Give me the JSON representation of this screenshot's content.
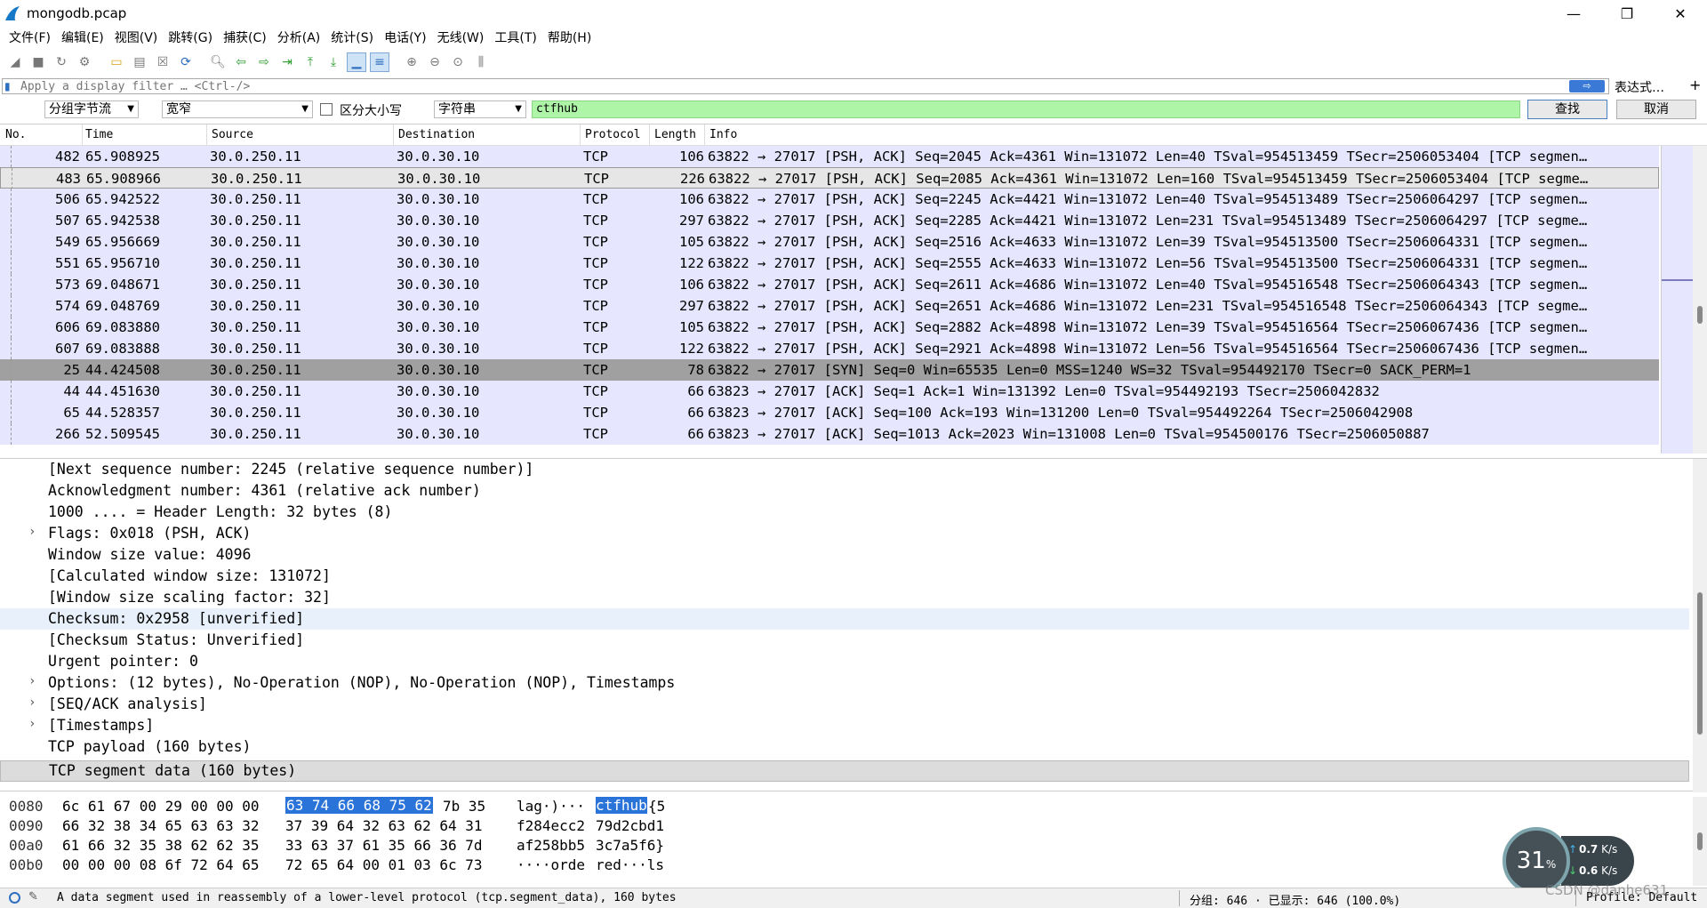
{
  "window": {
    "title": "mongodb.pcap",
    "minimize": "—",
    "restore": "❐",
    "close": "✕"
  },
  "menu": [
    "文件(F)",
    "编辑(E)",
    "视图(V)",
    "跳转(G)",
    "捕获(C)",
    "分析(A)",
    "统计(S)",
    "电话(Y)",
    "无线(W)",
    "工具(T)",
    "帮助(H)"
  ],
  "display_filter": {
    "placeholder": "Apply a display filter … <Ctrl-/>",
    "expression_label": "表达式…",
    "plus": "+"
  },
  "find_bar": {
    "search_in": "分组字节流",
    "char_width": "宽窄",
    "case_sensitive_label": "区分大小写",
    "search_type": "字符串",
    "query": "ctfhub",
    "find_label": "查找",
    "cancel_label": "取消"
  },
  "packet_list": {
    "columns": [
      "No.",
      "Time",
      "Source",
      "Destination",
      "Protocol",
      "Length",
      "Info"
    ],
    "rows": [
      {
        "no": "482",
        "time": "65.908925",
        "src": "30.0.250.11",
        "dst": "30.0.30.10",
        "proto": "TCP",
        "len": "106",
        "info": "63822 → 27017 [PSH, ACK] Seq=2045 Ack=4361 Win=131072 Len=40 TSval=954513459 TSecr=2506053404 [TCP segmen…"
      },
      {
        "no": "483",
        "time": "65.908966",
        "src": "30.0.250.11",
        "dst": "30.0.30.10",
        "proto": "TCP",
        "len": "226",
        "info": "63822 → 27017 [PSH, ACK] Seq=2085 Ack=4361 Win=131072 Len=160 TSval=954513459 TSecr=2506053404 [TCP segme…"
      },
      {
        "no": "506",
        "time": "65.942522",
        "src": "30.0.250.11",
        "dst": "30.0.30.10",
        "proto": "TCP",
        "len": "106",
        "info": "63822 → 27017 [PSH, ACK] Seq=2245 Ack=4421 Win=131072 Len=40 TSval=954513489 TSecr=2506064297 [TCP segmen…"
      },
      {
        "no": "507",
        "time": "65.942538",
        "src": "30.0.250.11",
        "dst": "30.0.30.10",
        "proto": "TCP",
        "len": "297",
        "info": "63822 → 27017 [PSH, ACK] Seq=2285 Ack=4421 Win=131072 Len=231 TSval=954513489 TSecr=2506064297 [TCP segme…"
      },
      {
        "no": "549",
        "time": "65.956669",
        "src": "30.0.250.11",
        "dst": "30.0.30.10",
        "proto": "TCP",
        "len": "105",
        "info": "63822 → 27017 [PSH, ACK] Seq=2516 Ack=4633 Win=131072 Len=39 TSval=954513500 TSecr=2506064331 [TCP segmen…"
      },
      {
        "no": "551",
        "time": "65.956710",
        "src": "30.0.250.11",
        "dst": "30.0.30.10",
        "proto": "TCP",
        "len": "122",
        "info": "63822 → 27017 [PSH, ACK] Seq=2555 Ack=4633 Win=131072 Len=56 TSval=954513500 TSecr=2506064331 [TCP segmen…"
      },
      {
        "no": "573",
        "time": "69.048671",
        "src": "30.0.250.11",
        "dst": "30.0.30.10",
        "proto": "TCP",
        "len": "106",
        "info": "63822 → 27017 [PSH, ACK] Seq=2611 Ack=4686 Win=131072 Len=40 TSval=954516548 TSecr=2506064343 [TCP segmen…"
      },
      {
        "no": "574",
        "time": "69.048769",
        "src": "30.0.250.11",
        "dst": "30.0.30.10",
        "proto": "TCP",
        "len": "297",
        "info": "63822 → 27017 [PSH, ACK] Seq=2651 Ack=4686 Win=131072 Len=231 TSval=954516548 TSecr=2506064343 [TCP segme…"
      },
      {
        "no": "606",
        "time": "69.083880",
        "src": "30.0.250.11",
        "dst": "30.0.30.10",
        "proto": "TCP",
        "len": "105",
        "info": "63822 → 27017 [PSH, ACK] Seq=2882 Ack=4898 Win=131072 Len=39 TSval=954516564 TSecr=2506067436 [TCP segmen…"
      },
      {
        "no": "607",
        "time": "69.083888",
        "src": "30.0.250.11",
        "dst": "30.0.30.10",
        "proto": "TCP",
        "len": "122",
        "info": "63822 → 27017 [PSH, ACK] Seq=2921 Ack=4898 Win=131072 Len=56 TSval=954516564 TSecr=2506067436 [TCP segmen…"
      },
      {
        "no": "25",
        "time": "44.424508",
        "src": "30.0.250.11",
        "dst": "30.0.30.10",
        "proto": "TCP",
        "len": "78",
        "info": "63822 → 27017 [SYN] Seq=0 Win=65535 Len=0 MSS=1240 WS=32 TSval=954492170 TSecr=0 SACK_PERM=1"
      },
      {
        "no": "44",
        "time": "44.451630",
        "src": "30.0.250.11",
        "dst": "30.0.30.10",
        "proto": "TCP",
        "len": "66",
        "info": "63823 → 27017 [ACK] Seq=1 Ack=1 Win=131392 Len=0 TSval=954492193 TSecr=2506042832"
      },
      {
        "no": "65",
        "time": "44.528357",
        "src": "30.0.250.11",
        "dst": "30.0.30.10",
        "proto": "TCP",
        "len": "66",
        "info": "63823 → 27017 [ACK] Seq=100 Ack=193 Win=131200 Len=0 TSval=954492264 TSecr=2506042908"
      },
      {
        "no": "266",
        "time": "52.509545",
        "src": "30.0.250.11",
        "dst": "30.0.30.10",
        "proto": "TCP",
        "len": "66",
        "info": "63823 → 27017 [ACK] Seq=1013 Ack=2023 Win=131008 Len=0 TSval=954500176 TSecr=2506050887"
      }
    ]
  },
  "details": [
    {
      "text": "[Next sequence number: 2245    (relative sequence number)]",
      "expandable": false
    },
    {
      "text": "Acknowledgment number: 4361    (relative ack number)",
      "expandable": false
    },
    {
      "text": "1000 .... = Header Length: 32 bytes (8)",
      "expandable": false
    },
    {
      "text": "Flags: 0x018 (PSH, ACK)",
      "expandable": true
    },
    {
      "text": "Window size value: 4096",
      "expandable": false
    },
    {
      "text": "[Calculated window size: 131072]",
      "expandable": false
    },
    {
      "text": "[Window size scaling factor: 32]",
      "expandable": false
    },
    {
      "text": "Checksum: 0x2958 [unverified]",
      "expandable": false
    },
    {
      "text": "[Checksum Status: Unverified]",
      "expandable": false
    },
    {
      "text": "Urgent pointer: 0",
      "expandable": false
    },
    {
      "text": "Options: (12 bytes), No-Operation (NOP), No-Operation (NOP), Timestamps",
      "expandable": true
    },
    {
      "text": "[SEQ/ACK analysis]",
      "expandable": true
    },
    {
      "text": "[Timestamps]",
      "expandable": true
    },
    {
      "text": "TCP payload (160 bytes)",
      "expandable": false
    },
    {
      "text": "TCP segment data (160 bytes)",
      "expandable": false
    }
  ],
  "bytes": [
    {
      "offset": "0080",
      "hex_a": "6c 61 67 00 29 00 00 00",
      "hex_hl": "63 74 66 68 75 62",
      "hex_b": "7b 35",
      "ascii_a": "lag·)··· ",
      "ascii_hl": "ctfhub",
      "ascii_b": "{5"
    },
    {
      "offset": "0090",
      "hex_a": "66 32 38 34 65 63 63 32",
      "hex_hl": "",
      "hex_b": "37 39 64 32 63 62 64 31",
      "ascii_a": "f284ecc2 ",
      "ascii_hl": "",
      "ascii_b": "79d2cbd1"
    },
    {
      "offset": "00a0",
      "hex_a": "61 66 32 35 38 62 62 35",
      "hex_hl": "",
      "hex_b": "33 63 37 61 35 66 36 7d",
      "ascii_a": "af258bb5 ",
      "ascii_hl": "",
      "ascii_b": "3c7a5f6}"
    },
    {
      "offset": "00b0",
      "hex_a": "00 00 00 08 6f 72 64 65",
      "hex_hl": "",
      "hex_b": "72 65 64 00 01 03 6c 73",
      "ascii_a": "····orde ",
      "ascii_hl": "",
      "ascii_b": "red···ls"
    }
  ],
  "speed_widget": {
    "percent": "31",
    "percent_unit": "%",
    "up": "0.7",
    "up_unit": "K/s",
    "down": "0.6",
    "down_unit": "K/s"
  },
  "status": {
    "message": "A data segment used in reassembly of a lower-level protocol (tcp.segment_data), 160 bytes",
    "packets": "分组: 646 · 已显示: 646 (100.0%)",
    "profile": "Profile: Default"
  },
  "watermark": "CSDN @danhe631"
}
